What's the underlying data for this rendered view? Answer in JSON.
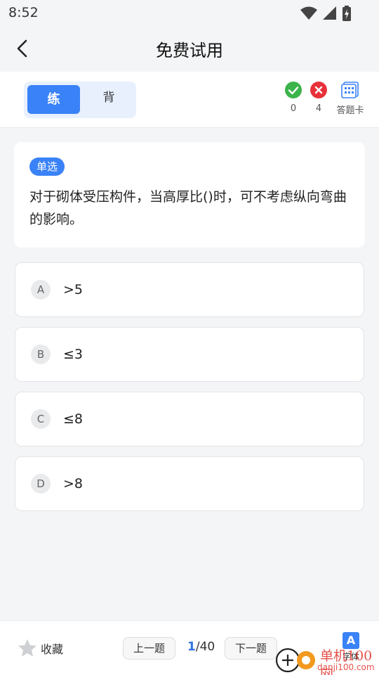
{
  "status_bar": {
    "time": "8:52",
    "icons": [
      "wifi-icon",
      "signal-icon",
      "battery-icon"
    ]
  },
  "header": {
    "title": "免费试用",
    "back_icon": "chevron-left-icon"
  },
  "mode": {
    "practice_label": "练",
    "recite_label": "背",
    "active": "练",
    "accent": "#3a82f7"
  },
  "stats": {
    "correct_count": "0",
    "wrong_count": "4",
    "answer_card_label": "答题卡",
    "correct_color": "#3cb44b",
    "wrong_color": "#e8313a"
  },
  "question": {
    "type_label": "单选",
    "text": "对于砌体受压构件，当高厚比()时，可不考虑纵向弯曲的影响。"
  },
  "options": [
    {
      "letter": "A",
      "text": ">5"
    },
    {
      "letter": "B",
      "text": "≤3"
    },
    {
      "letter": "C",
      "text": "≤8"
    },
    {
      "letter": "D",
      "text": ">8"
    }
  ],
  "bottom": {
    "favorite_label": "收藏",
    "prev_label": "上一题",
    "next_label": "下一题",
    "current": "1",
    "total": "/40",
    "font_icon_letter": "A",
    "font_label": "字体"
  },
  "watermark": {
    "text": "单机100网",
    "url": "danji100.com"
  }
}
